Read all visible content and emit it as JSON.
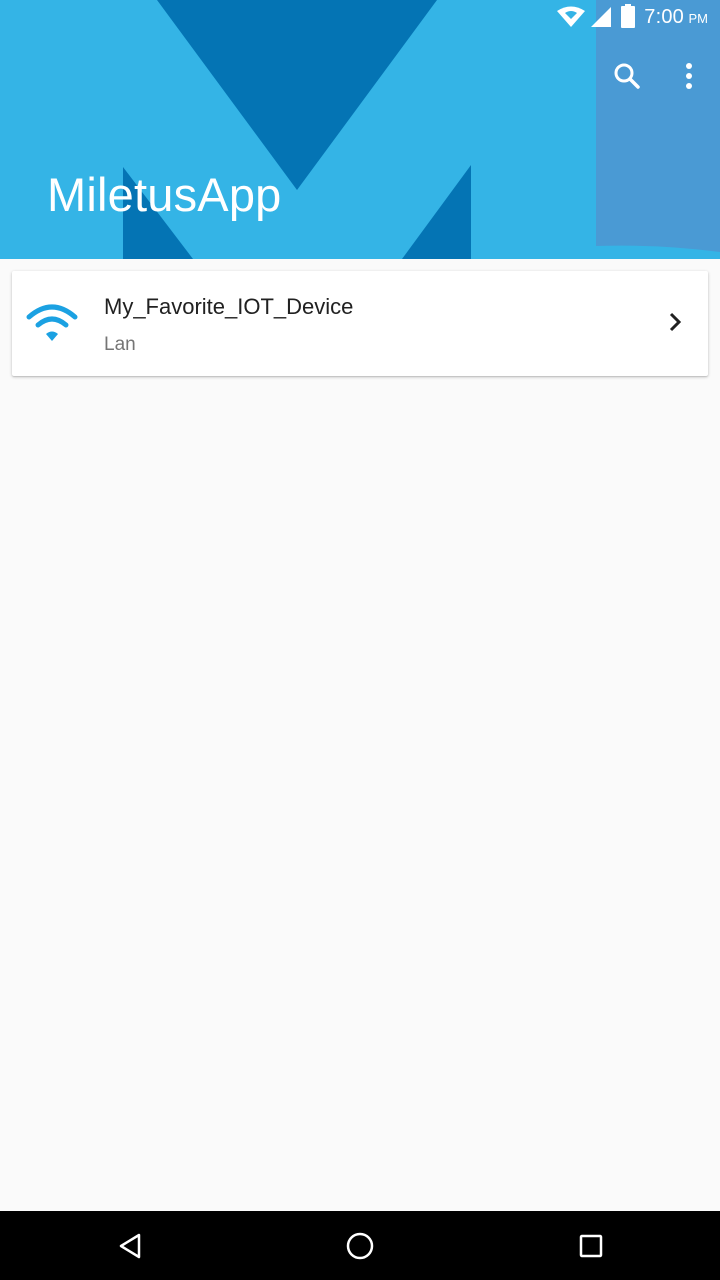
{
  "status_bar": {
    "time": "7:00",
    "ampm": "PM",
    "icons": [
      "wifi-icon",
      "cell-signal-icon",
      "battery-icon"
    ]
  },
  "toolbar": {
    "title": "MiletusApp",
    "actions": [
      "search-icon",
      "more-vert-icon"
    ]
  },
  "colors": {
    "banner": "#34b4e6",
    "banner_dark": "#0474b4",
    "banner_side": "#4a9ad4",
    "accent": "#1ba1e2"
  },
  "devices": [
    {
      "name": "My_Favorite_IOT_Device",
      "connection": "Lan",
      "icon": "wifi-icon",
      "action_icon": "chevron-right-icon"
    }
  ],
  "nav_bar": {
    "buttons": [
      "back-icon",
      "home-icon",
      "recents-icon"
    ]
  }
}
